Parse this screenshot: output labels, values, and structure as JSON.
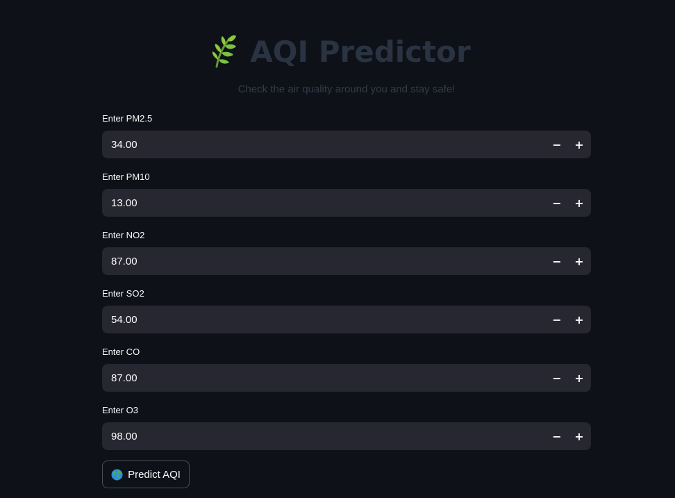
{
  "header": {
    "title": "AQI Predictor",
    "subtitle": "Check the air quality around you and stay safe!",
    "logo_icon": "leaf-icon"
  },
  "fields": [
    {
      "label": "Enter PM2.5",
      "value": "34.00"
    },
    {
      "label": "Enter PM10",
      "value": "13.00"
    },
    {
      "label": "Enter NO2",
      "value": "87.00"
    },
    {
      "label": "Enter SO2",
      "value": "54.00"
    },
    {
      "label": "Enter CO",
      "value": "87.00"
    },
    {
      "label": "Enter O3",
      "value": "98.00"
    }
  ],
  "stepper": {
    "minus_label": "−",
    "plus_label": "+"
  },
  "predict_button": {
    "label": "Predict AQI",
    "icon": "globe-icon"
  },
  "colors": {
    "background": "#0e1117",
    "input_background": "#262730",
    "title": "#2a3342",
    "leaf": "#7cc242"
  }
}
